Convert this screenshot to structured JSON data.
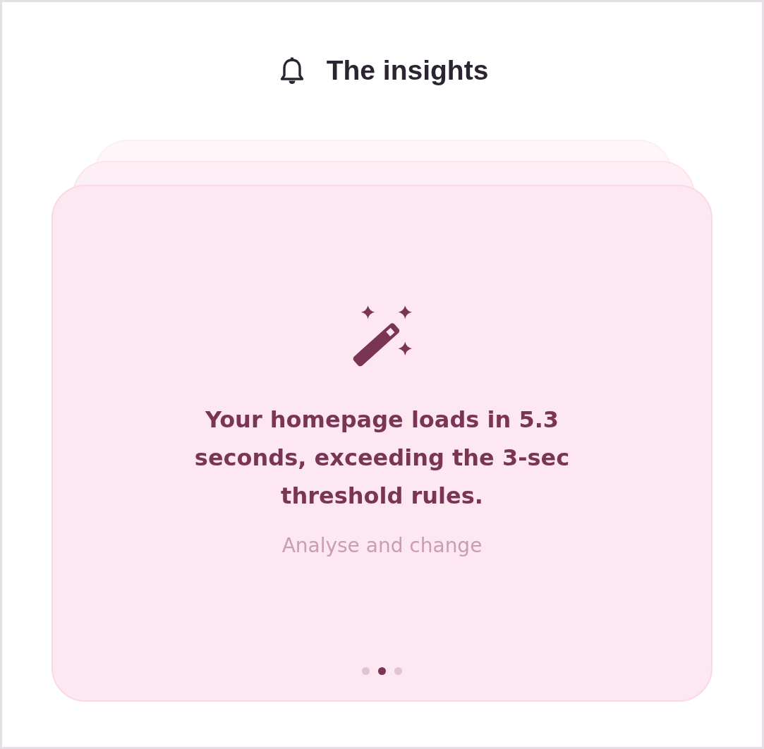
{
  "header": {
    "title": "The insights"
  },
  "card": {
    "message": "Your homepage loads in 5.3 seconds, exceeding the 3-sec threshold rules.",
    "action": "Analyse and change",
    "pager": [
      {
        "selected": false
      },
      {
        "selected": true
      },
      {
        "selected": false
      }
    ]
  }
}
